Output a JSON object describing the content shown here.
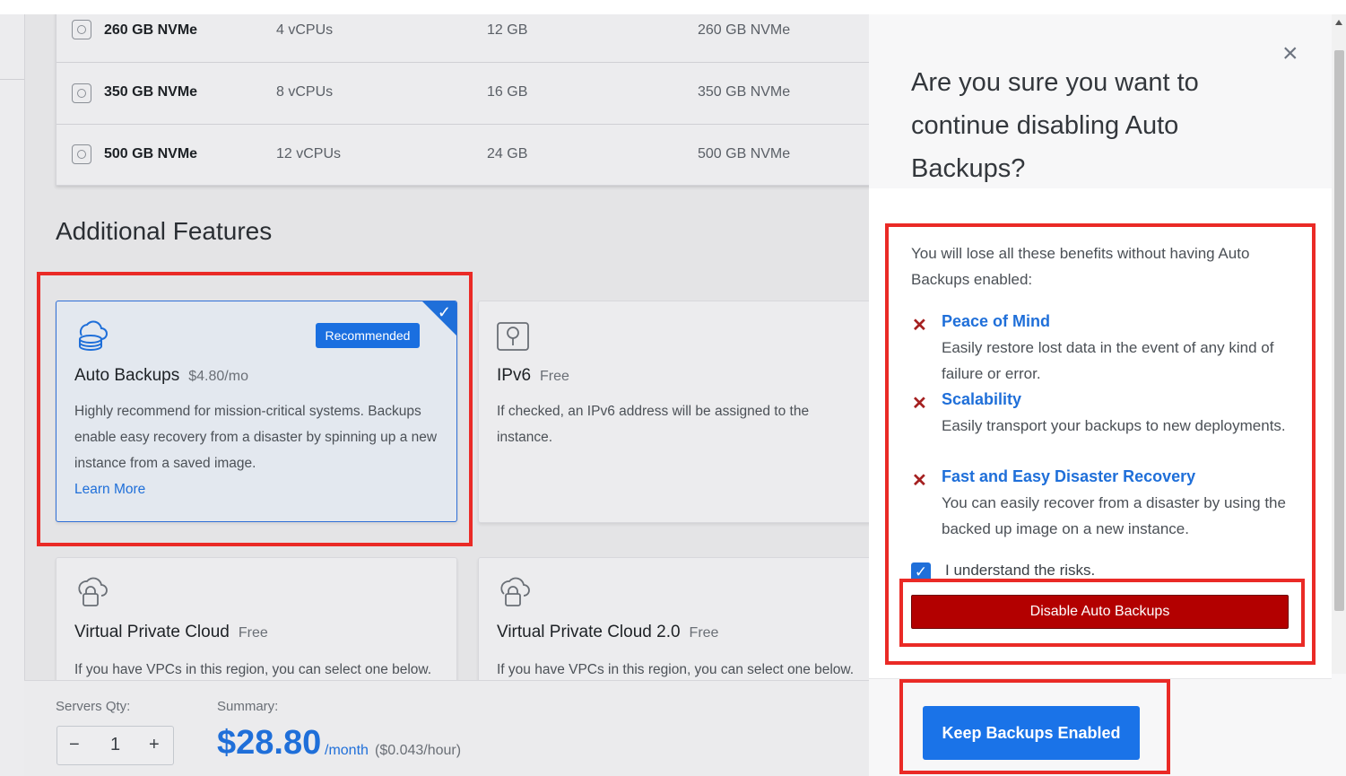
{
  "plans": [
    {
      "name": "260 GB NVMe",
      "cpu": "4 vCPUs",
      "ram": "12 GB",
      "storage": "260 GB NVMe"
    },
    {
      "name": "350 GB NVMe",
      "cpu": "8 vCPUs",
      "ram": "16 GB",
      "storage": "350 GB NVMe"
    },
    {
      "name": "500 GB NVMe",
      "cpu": "12 vCPUs",
      "ram": "24 GB",
      "storage": "500 GB NVMe"
    }
  ],
  "features": {
    "section_title": "Additional Features",
    "auto_backups": {
      "title": "Auto Backups",
      "price": "$4.80/mo",
      "badge": "Recommended",
      "description": "Highly recommend for mission-critical systems. Backups enable easy recovery from a disaster by spinning up a new instance from a saved image.",
      "link": "Learn More",
      "selected": true
    },
    "ipv6": {
      "title": "IPv6",
      "price": "Free",
      "description": "If checked, an IPv6 address will be assigned to the instance."
    },
    "vpc": {
      "title": "Virtual Private Cloud",
      "price": "Free",
      "description": "If you have VPCs in this region, you can select one below."
    },
    "vpc2": {
      "title": "Virtual Private Cloud 2.0",
      "price": "Free",
      "description": "If you have VPCs in this region, you can select one below."
    }
  },
  "summary_bar": {
    "qty_label": "Servers Qty:",
    "qty_value": "1",
    "minus": "−",
    "plus": "+",
    "summary_label": "Summary:",
    "price": "$28.80",
    "unit": "/month",
    "hourly": "($0.043/hour)"
  },
  "modal": {
    "close": "×",
    "title": "Are you sure you want to continue disabling Auto Backups?",
    "intro": "You will lose all these benefits without having Auto Backups enabled:",
    "benefits": [
      {
        "title": "Peace of Mind",
        "desc": "Easily restore lost data in the event of any kind of failure or error."
      },
      {
        "title": "Scalability",
        "desc": "Easily transport your backups to new deployments."
      },
      {
        "title": "Fast and Easy Disaster Recovery",
        "desc": "You can easily recover from a disaster by using the backed up image on a new instance."
      }
    ],
    "x_mark": "✕",
    "checkbox_label": "I understand the risks.",
    "checkbox_checked": true,
    "disable_button": "Disable Auto Backups",
    "keep_button": "Keep Backups Enabled"
  },
  "colors": {
    "accent": "#1f6fd9",
    "danger": "#b30000",
    "highlight": "#ea2a26"
  },
  "icons": {
    "plan": "server-chip-icon",
    "auto_backups": "cloud-database-icon",
    "ipv6": "map-location-icon",
    "vpc": "cloud-lock-icon",
    "check": "checkmark-icon"
  }
}
